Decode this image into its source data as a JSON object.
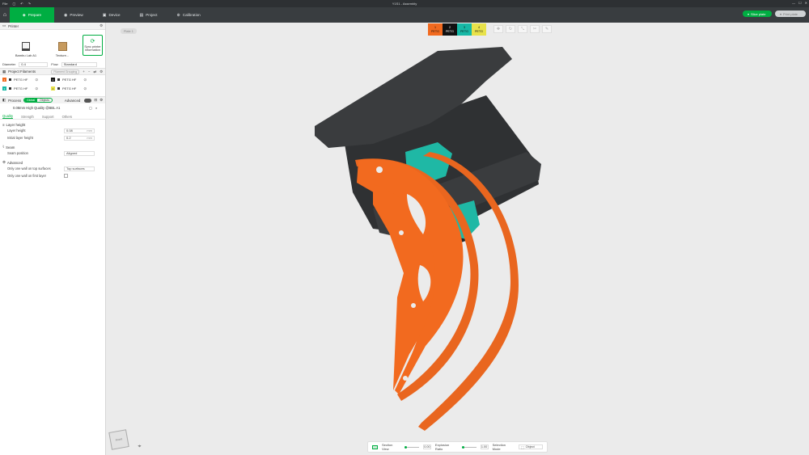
{
  "titlebar": {
    "menu": "File",
    "title": "Y1S1 - Assembly",
    "window_controls": [
      "—",
      "☐",
      "✕"
    ]
  },
  "tabs": [
    {
      "label": "Prepare",
      "icon": "cube-icon"
    },
    {
      "label": "Preview",
      "icon": "eye-icon"
    },
    {
      "label": "Device",
      "icon": "device-icon"
    },
    {
      "label": "Project",
      "icon": "folder-icon"
    },
    {
      "label": "Calibration",
      "icon": "calibration-icon"
    }
  ],
  "actions": {
    "slice": "Slice plate",
    "print": "Print plate"
  },
  "printer": {
    "heading": "Printer",
    "name": "Bambu Lab A1",
    "plate": "Texture...",
    "sync": "Sync printer information",
    "nozzle_label": "Diameter",
    "nozzle_value": "0.4",
    "flow_label": "Flow",
    "flow_value": "Standard"
  },
  "filaments": {
    "heading": "Project Filaments",
    "grouping": "Filament Grouping",
    "items": [
      {
        "num": "1",
        "color": "#f26a1f",
        "name": "PETG HF"
      },
      {
        "num": "2",
        "color": "#111111",
        "name": "PETG HF"
      },
      {
        "num": "3",
        "color": "#17b8a6",
        "name": "PETG HF"
      },
      {
        "num": "4",
        "color": "#e8e24a",
        "name": "PETG HF"
      }
    ]
  },
  "process": {
    "heading": "Process",
    "mode_on": "Global",
    "mode_off": "Objects",
    "advanced": "Advanced",
    "preset": "0.08mm High Quality @BBL A1",
    "subtabs": [
      "Quality",
      "Strength",
      "Support",
      "Others"
    ],
    "groups": {
      "layer_height": "Layer height",
      "seam": "Seam",
      "advanced": "Advanced"
    },
    "layer_height_label": "Layer height",
    "layer_height_value": "0.08",
    "initial_layer_label": "Initial layer height",
    "initial_layer_value": "0.2",
    "unit": "mm",
    "seam_label": "Seam position",
    "seam_value": "Aligned",
    "one_wall_top_label": "Only one wall on top surfaces",
    "one_wall_top_value": "Top surfaces",
    "one_wall_first_label": "Only one wall on first layer"
  },
  "viewport": {
    "pill": "Plate 1",
    "swatches": [
      {
        "num": "1",
        "type": "PETG",
        "color": "#f26a1f",
        "text": "#111"
      },
      {
        "num": "2",
        "type": "PETG",
        "color": "#111111",
        "text": "#fff"
      },
      {
        "num": "3",
        "type": "PETG",
        "color": "#17b8a6",
        "text": "#111"
      },
      {
        "num": "4",
        "type": "PETG",
        "color": "#e8e24a",
        "text": "#111"
      }
    ],
    "cube_label": "Front",
    "section_view": "Section View",
    "section_value": "0.00",
    "explosion_ratio": "Explosion Ratio",
    "explosion_value": "1.00",
    "selection_mode": "Selection Mode",
    "selection_value": "Object"
  }
}
